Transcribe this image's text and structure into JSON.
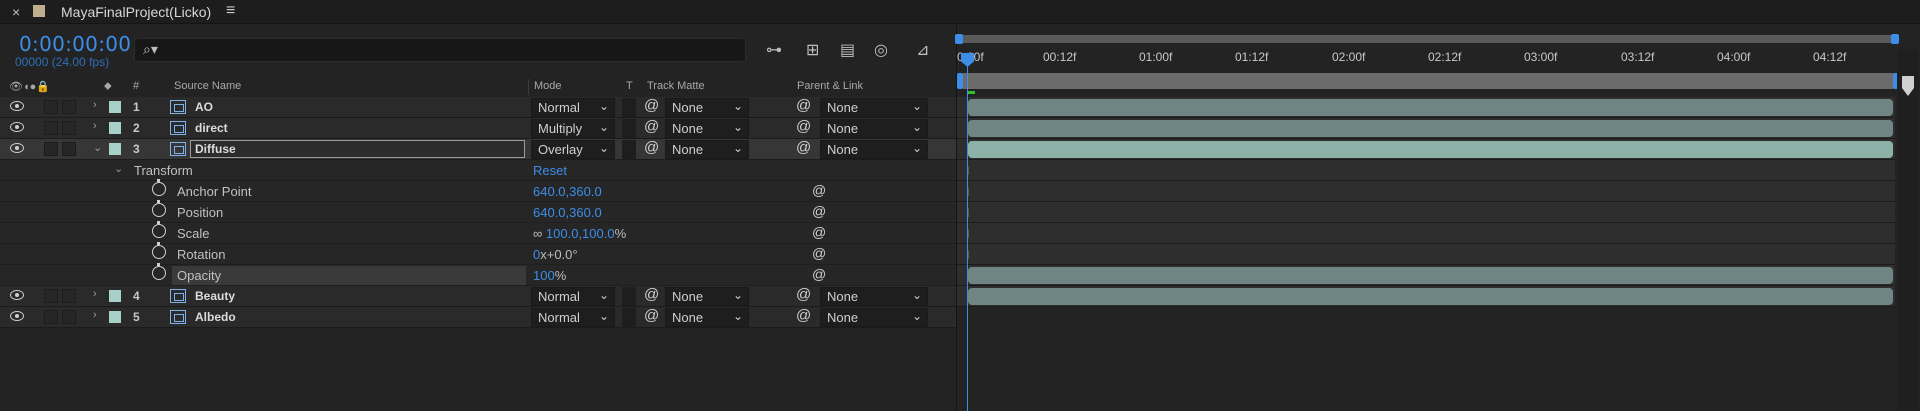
{
  "tab": {
    "close_icon": "close-icon",
    "title": "MayaFinalProject(Licko)",
    "menu_icon": "hamburger-menu-icon"
  },
  "header": {
    "timecode": "0:00:00:00",
    "fps": "00000 (24.00 fps)",
    "search_placeholder": ""
  },
  "columns": {
    "hash": "#",
    "source_name": "Source Name",
    "mode": "Mode",
    "t": "T",
    "track_matte": "Track Matte",
    "parent_link": "Parent & Link"
  },
  "layers": [
    {
      "num": "1",
      "name": "AO",
      "mode": "Normal",
      "matte": "None",
      "parent": "None"
    },
    {
      "num": "2",
      "name": "direct",
      "mode": "Multiply",
      "matte": "None",
      "parent": "None"
    },
    {
      "num": "3",
      "name": "Diffuse",
      "mode": "Overlay",
      "matte": "None",
      "parent": "None"
    },
    {
      "num": "4",
      "name": "Beauty",
      "mode": "Normal",
      "matte": "None",
      "parent": "None"
    },
    {
      "num": "5",
      "name": "Albedo",
      "mode": "Normal",
      "matte": "None",
      "parent": "None"
    }
  ],
  "transform": {
    "label": "Transform",
    "reset": "Reset",
    "props": [
      {
        "name": "Anchor Point",
        "value": "640.0,360.0",
        "unit": ""
      },
      {
        "name": "Position",
        "value": "640.0,360.0",
        "unit": ""
      },
      {
        "name": "Scale",
        "value": "100.0,100.0",
        "unit": "%"
      },
      {
        "name": "Rotation",
        "value": "0",
        "unit": "x+0.0°"
      },
      {
        "name": "Opacity",
        "value": "100",
        "unit": "%"
      }
    ]
  },
  "ruler": [
    "0:00f",
    "00:12f",
    "01:00f",
    "01:12f",
    "02:00f",
    "02:12f",
    "03:00f",
    "03:12f",
    "04:00f",
    "04:12f"
  ],
  "accent_color": "#3d8ee8",
  "label_color": "#a8d0c8"
}
